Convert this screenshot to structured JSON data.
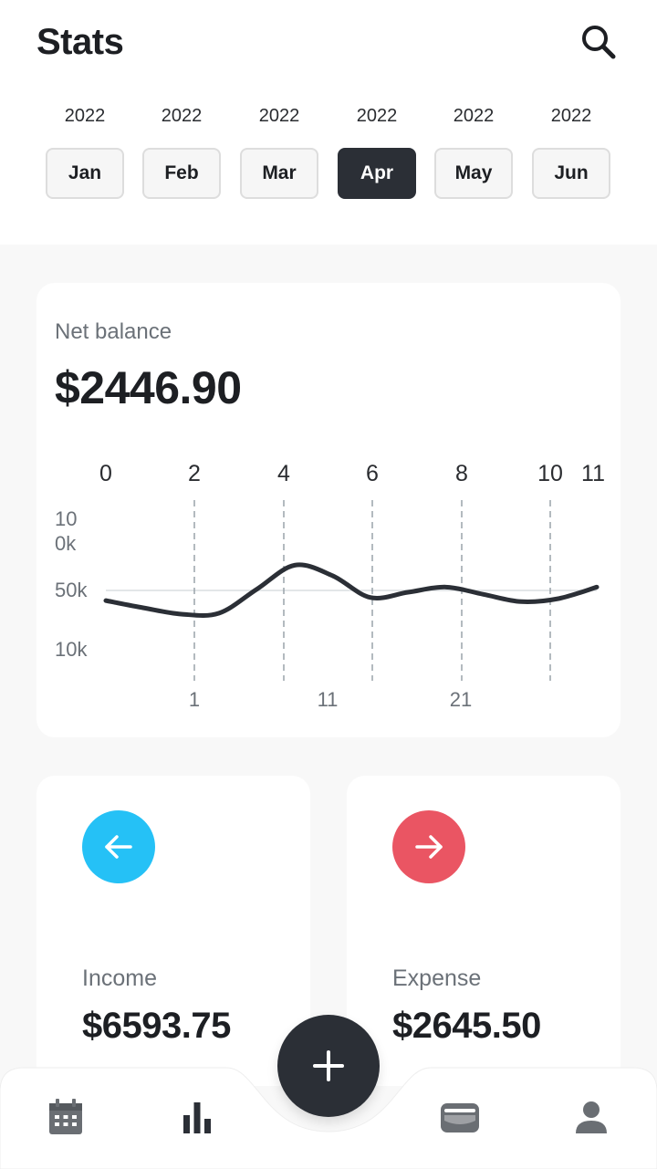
{
  "header": {
    "title": "Stats",
    "search_icon": "search-icon"
  },
  "months": [
    {
      "year": "2022",
      "label": "Jan",
      "selected": false
    },
    {
      "year": "2022",
      "label": "Feb",
      "selected": false
    },
    {
      "year": "2022",
      "label": "Mar",
      "selected": false
    },
    {
      "year": "2022",
      "label": "Apr",
      "selected": true
    },
    {
      "year": "2022",
      "label": "May",
      "selected": false
    },
    {
      "year": "2022",
      "label": "Jun",
      "selected": false
    }
  ],
  "balance": {
    "label": "Net balance",
    "amount": "$2446.90"
  },
  "chart_data": {
    "type": "line",
    "title": "",
    "top_tick_labels": [
      "0",
      "2",
      "4",
      "6",
      "8",
      "10",
      "11"
    ],
    "bottom_tick_labels": [
      "1",
      "11",
      "21"
    ],
    "y_tick_labels": [
      "10\n0k",
      "50k",
      "10k"
    ],
    "series": [
      {
        "values": [
          49000,
          42000,
          36000,
          37000,
          60000,
          83000,
          73000,
          52000,
          57000,
          62000,
          55000,
          48000,
          51000,
          62000
        ]
      }
    ],
    "grid": "vertical dashed",
    "colors": {
      "line": "#2b2f36",
      "grid": "#9aa3aa",
      "baseline": "#e3e6e8"
    }
  },
  "income": {
    "label": "Income",
    "amount": "$6593.75",
    "icon": "arrow-left-icon",
    "color": "#25c1f6"
  },
  "expense": {
    "label": "Expense",
    "amount": "$2645.50",
    "icon": "arrow-right-icon",
    "color": "#ea5563"
  },
  "nav": {
    "items": [
      {
        "icon": "calendar-icon"
      },
      {
        "icon": "bar-chart-icon"
      },
      {
        "icon": "wallet-icon"
      },
      {
        "icon": "profile-icon"
      }
    ],
    "fab_icon": "plus-icon"
  }
}
